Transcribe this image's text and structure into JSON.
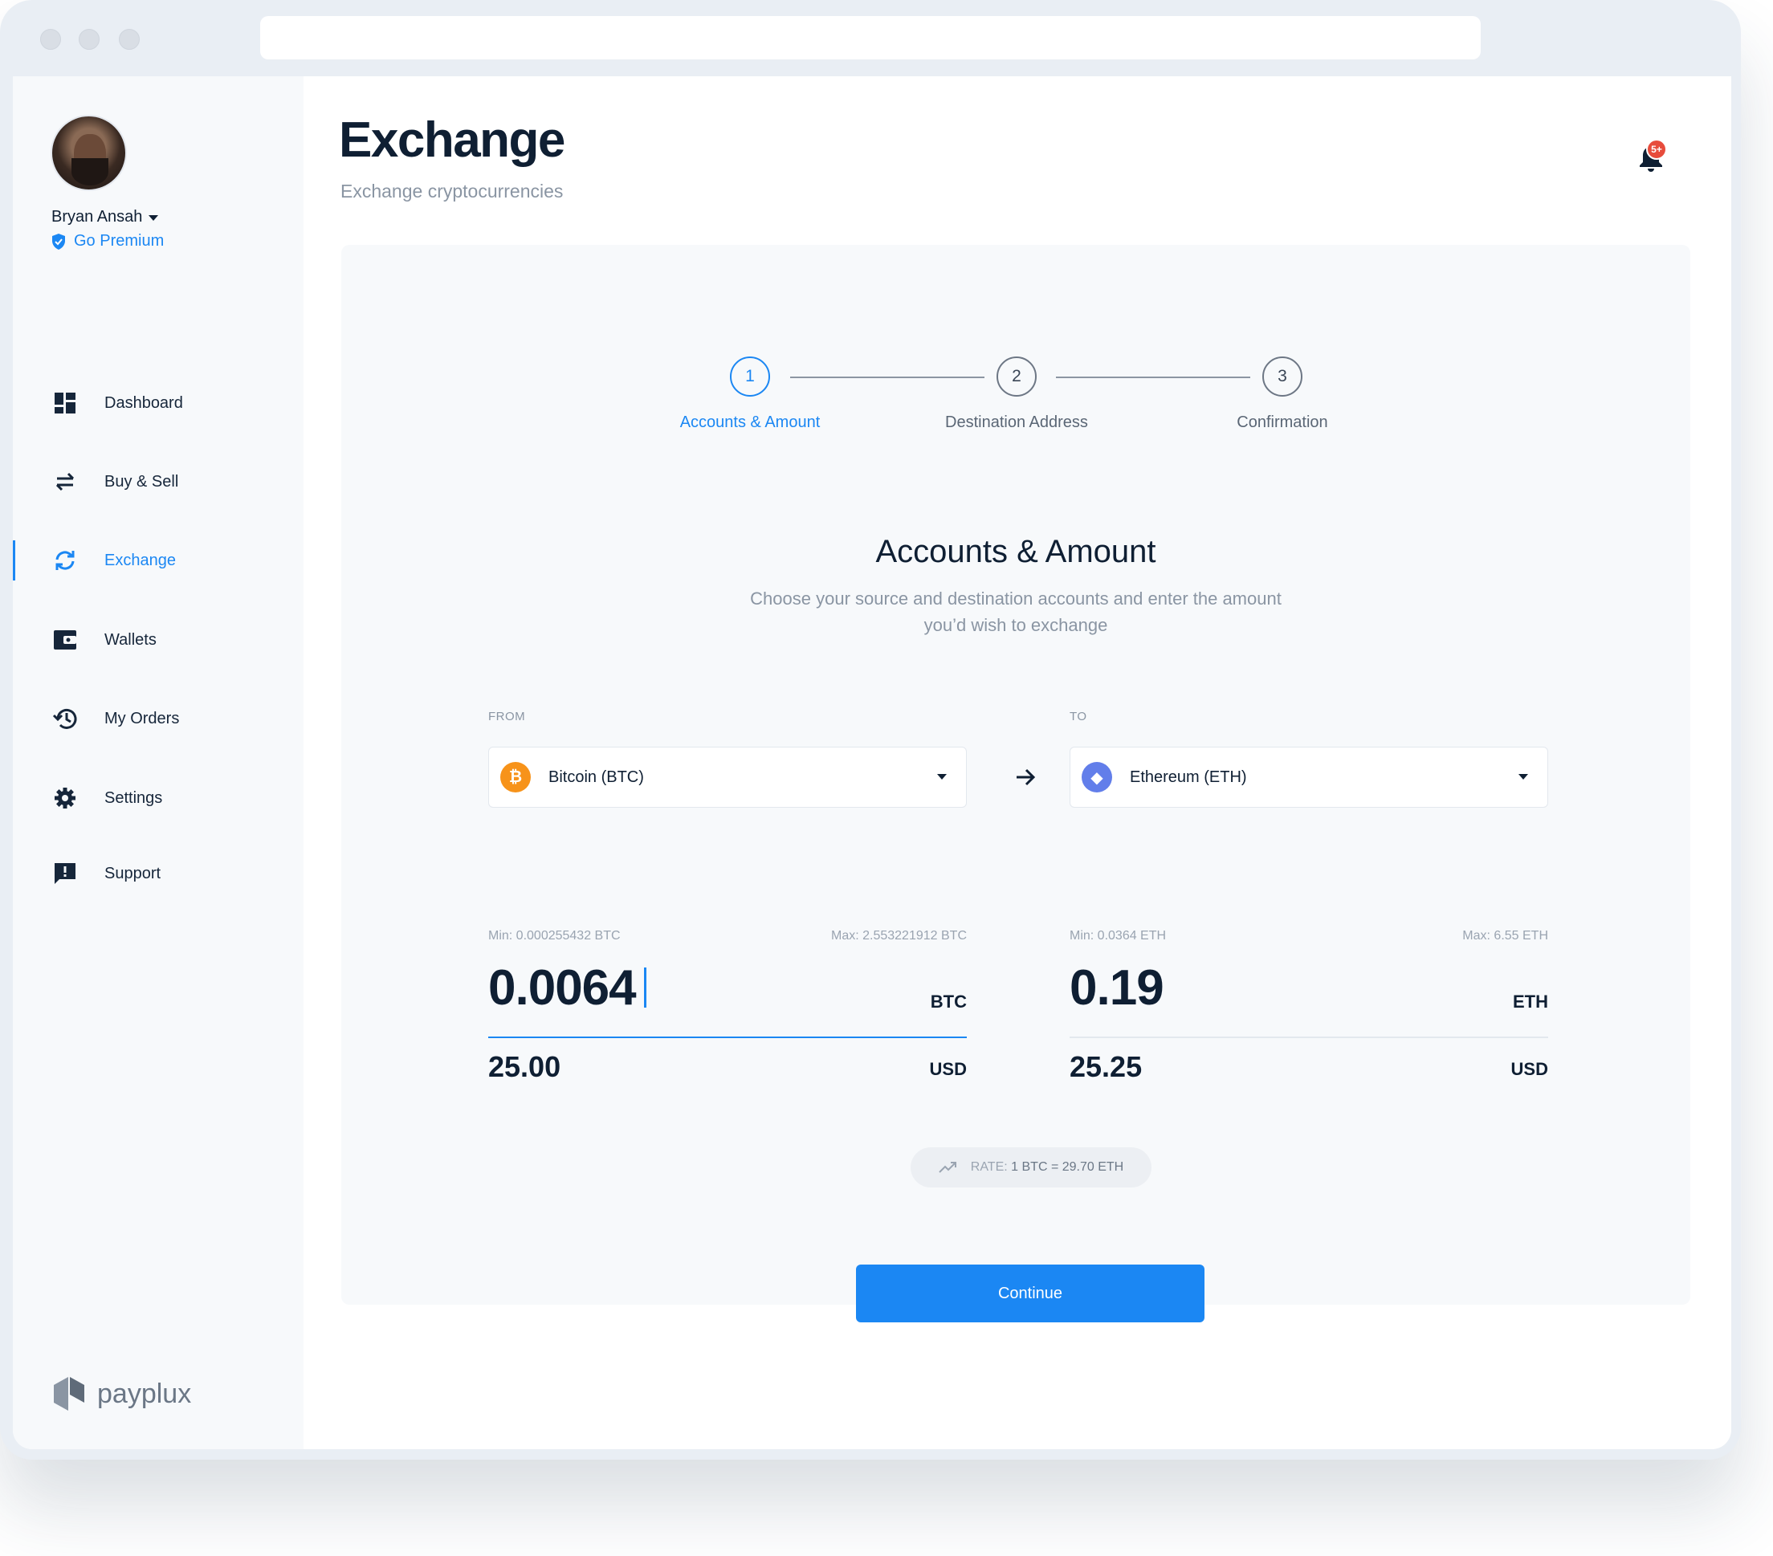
{
  "user": {
    "name": "Bryan Ansah",
    "premium_label": "Go Premium"
  },
  "nav": [
    {
      "label": "Dashboard",
      "icon": "dashboard-icon"
    },
    {
      "label": "Buy & Sell",
      "icon": "swap-icon"
    },
    {
      "label": "Exchange",
      "icon": "refresh-icon",
      "active": true
    },
    {
      "label": "Wallets",
      "icon": "wallet-icon"
    },
    {
      "label": "My Orders",
      "icon": "history-icon"
    },
    {
      "label": "Settings",
      "icon": "gear-icon"
    },
    {
      "label": "Support",
      "icon": "feedback-icon"
    }
  ],
  "brand": {
    "name": "payplux"
  },
  "header": {
    "title": "Exchange",
    "subtitle": "Exchange cryptocurrencies",
    "notification_badge": "5+"
  },
  "steps": [
    {
      "number": "1",
      "label": "Accounts & Amount",
      "active": true
    },
    {
      "number": "2",
      "label": "Destination Address"
    },
    {
      "number": "3",
      "label": "Confirmation"
    }
  ],
  "section": {
    "title": "Accounts & Amount",
    "description": "Choose your source and destination accounts and enter the amount you’d wish to exchange"
  },
  "from": {
    "label": "FROM",
    "coin_symbol": "₿",
    "currency": "Bitcoin (BTC)",
    "min": "Min: 0.000255432 BTC",
    "max": "Max: 2.553221912 BTC",
    "amount": "0.0064",
    "unit": "BTC",
    "usd_amount": "25.00",
    "usd_unit": "USD"
  },
  "to": {
    "label": "TO",
    "coin_symbol": "◆",
    "currency": "Ethereum (ETH)",
    "min": "Min: 0.0364 ETH",
    "max": "Max: 6.55 ETH",
    "amount": "0.19",
    "unit": "ETH",
    "usd_amount": "25.25",
    "usd_unit": "USD"
  },
  "rate": {
    "prefix": "RATE:",
    "value": "1 BTC = 29.70 ETH"
  },
  "actions": {
    "continue_label": "Continue"
  },
  "colors": {
    "accent": "#1b87f3",
    "btc": "#f7931a",
    "eth": "#627eea",
    "badge": "#e74c3c"
  }
}
